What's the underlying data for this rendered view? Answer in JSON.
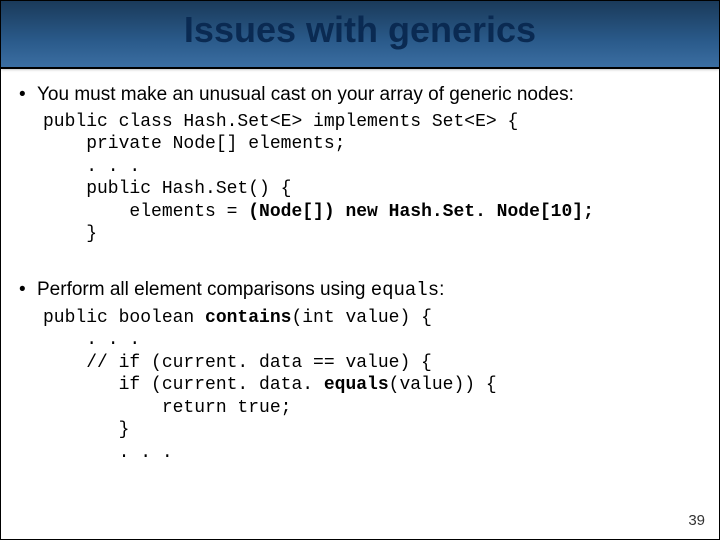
{
  "title": "Issues with generics",
  "bullets": {
    "b1": "You must make an unusual cast on your array of generic nodes:",
    "b2_prefix": "Perform all element comparisons using ",
    "b2_code": "equals",
    "b2_suffix": ":"
  },
  "code1": {
    "l1": "public class Hash.Set<E> implements Set<E> {",
    "l2": "    private Node[] elements;",
    "l3": "    . . .",
    "l4": "    public Hash.Set() {",
    "l5_pre": "        elements = ",
    "l5_b": "(Node[]) new Hash.Set. Node[10];",
    "l6": "    }"
  },
  "code2": {
    "l1_pre": "public boolean ",
    "l1_b": "contains",
    "l1_post": "(int value) {",
    "l2": "    . . .",
    "l3": "    // if (current. data == value) {",
    "l4_pre": "       if (current. data.",
    "l4_b": " equals",
    "l4_post": "(value)) {",
    "l5": "           return true;",
    "l6": "       }",
    "l7": "       . . ."
  },
  "page_number": "39"
}
